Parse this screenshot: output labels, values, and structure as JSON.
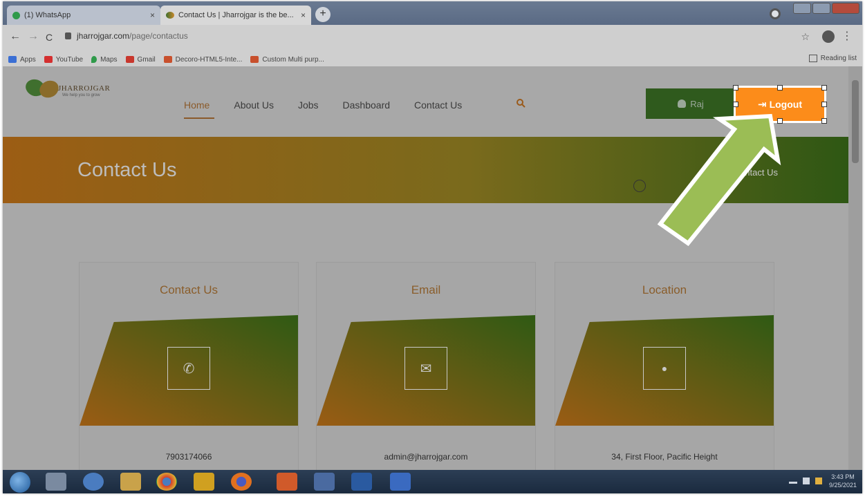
{
  "browser": {
    "tabs": [
      {
        "label": "(1) WhatsApp",
        "close": "×"
      },
      {
        "label": "Contact Us | Jharrojgar is the be...",
        "close": "×"
      }
    ],
    "new_tab": "+",
    "nav": {
      "back": "←",
      "forward": "→",
      "reload": "C"
    },
    "url_domain": "jharrojgar.com",
    "url_path": "/page/contactus",
    "star": "☆",
    "kebab": "⋮",
    "bookmarks": [
      {
        "label": "Apps",
        "color": "#3b6fd4"
      },
      {
        "label": "YouTube",
        "color": "#d42f2f"
      },
      {
        "label": "Maps",
        "color": "#2f9a4a"
      },
      {
        "label": "Gmail",
        "color": "#c8372d"
      },
      {
        "label": "Decoro-HTML5-Inte...",
        "color": "#c8502d"
      },
      {
        "label": "Custom Multi purp...",
        "color": "#c8502d"
      }
    ],
    "reading_list": "Reading list"
  },
  "site": {
    "logo": {
      "brand": "JHARROJGAR",
      "tagline": "We help you to grow"
    },
    "nav": [
      "Home",
      "About Us",
      "Jobs",
      "Dashboard",
      "Contact Us"
    ],
    "active_nav": "Home",
    "user_button": "Raj",
    "logout_button": "Logout",
    "banner_title": "Contact Us",
    "banner_crumb": "Home / Contact Us",
    "cards": [
      {
        "title": "Contact Us",
        "value": "7903174066",
        "icon": "phone-icon",
        "glyph": "✆"
      },
      {
        "title": "Email",
        "value": "admin@jharrojgar.com",
        "icon": "envelope-icon",
        "glyph": "✉"
      },
      {
        "title": "Location",
        "value": "34, First Floor, Pacific Height",
        "icon": "map-pin-icon",
        "glyph": "●"
      }
    ]
  },
  "taskbar": {
    "clock_time": "3:43 PM",
    "clock_date": "9/25/2021"
  },
  "colors": {
    "accent_orange": "#fc8c1a",
    "accent_green": "#2f5a1d",
    "annotation_arrow": "#9bbd55"
  }
}
